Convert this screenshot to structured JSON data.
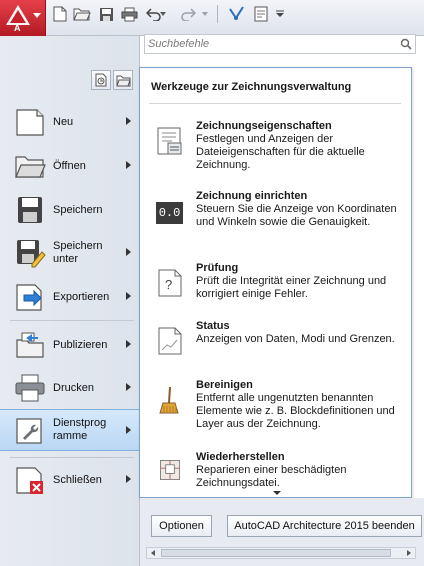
{
  "app": {
    "letter": "A",
    "accent": "#d0272f"
  },
  "quick_access": {
    "icons": [
      "new-icon",
      "open-icon",
      "save-icon",
      "print-icon",
      "undo-icon",
      "redo-icon",
      "workspace-icon",
      "layer-icon",
      "customize-icon"
    ]
  },
  "search": {
    "placeholder": "Suchbefehle"
  },
  "menu": {
    "items": [
      {
        "label": "Neu",
        "icon": "new-document-icon"
      },
      {
        "label": "Öffnen",
        "icon": "open-folder-icon"
      },
      {
        "label": "Speichern",
        "icon": "floppy-disk-icon"
      },
      {
        "label": "Speichern\nunter",
        "icon": "save-as-icon"
      },
      {
        "label": "Exportieren",
        "icon": "export-icon"
      },
      {
        "label": "Publizieren",
        "icon": "publish-icon"
      },
      {
        "label": "Drucken",
        "icon": "printer-icon"
      },
      {
        "label": "Dienstprog\nramme",
        "icon": "wrench-icon"
      },
      {
        "label": "Schließen",
        "icon": "close-document-icon"
      }
    ]
  },
  "submenu": {
    "title": "Werkzeuge zur Zeichnungsverwaltung",
    "items": [
      {
        "title": "Zeichnungseigenschaften",
        "description": "Festlegen und Anzeigen der Dateieigenschaften für die aktuelle Zeichnung.",
        "icon": "drawing-properties-icon"
      },
      {
        "title": "Zeichnung einrichten",
        "description": "Steuern Sie die Anzeige von Koordinaten und Winkeln sowie die Genauigkeit.",
        "icon": "units-icon",
        "icon_text": "0.0"
      },
      {
        "title": "Prüfung",
        "description": "Prüft die Integrität einer Zeichnung und korrigiert einige Fehler.",
        "icon": "audit-icon",
        "icon_text": "?"
      },
      {
        "title": "Status",
        "description": "Anzeigen von Daten, Modi und Grenzen.",
        "icon": "status-icon"
      },
      {
        "title": "Bereinigen",
        "description": "Entfernt alle ungenutzten benannten Elemente wie z. B. Blockdefinitionen und Layer aus der Zeichnung.",
        "icon": "broom-icon"
      },
      {
        "title": "Wiederherstellen",
        "description": "Reparieren einer beschädigten Zeichnungsdatei.",
        "icon": "recover-icon"
      }
    ]
  },
  "footer": {
    "options_label": "Optionen",
    "exit_label": "AutoCAD Architecture 2015 beenden"
  }
}
